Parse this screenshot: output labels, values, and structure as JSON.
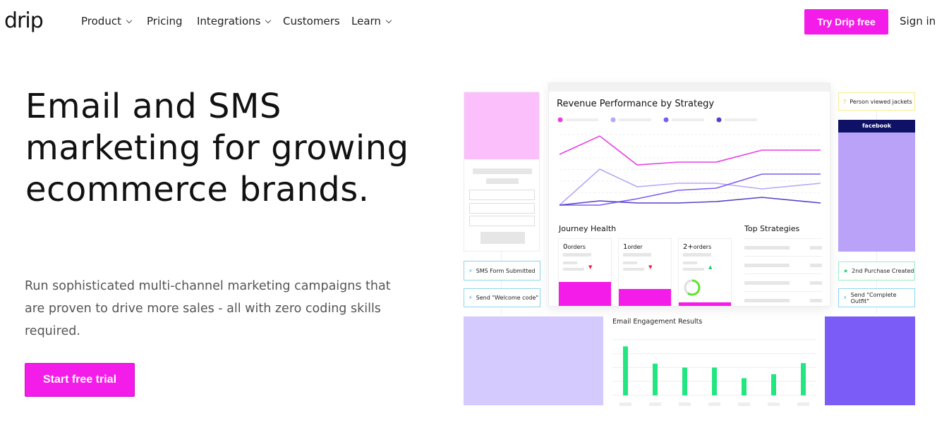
{
  "nav": {
    "logo": "drip",
    "items": [
      {
        "label": "Product",
        "dropdown": true
      },
      {
        "label": "Pricing",
        "dropdown": false
      },
      {
        "label": "Integrations",
        "dropdown": true
      },
      {
        "label": "Customers",
        "dropdown": false
      },
      {
        "label": "Learn",
        "dropdown": true
      }
    ],
    "try_label": "Try Drip free",
    "signin_label": "Sign in"
  },
  "hero": {
    "title": "Email and SMS marketing for growing ecommerce brands.",
    "subtitle": "Run sophisticated multi-channel marketing campaigns that are proven to drive more sales - all with zero coding skills required.",
    "cta_label": "Start free trial"
  },
  "illustration": {
    "revenue_title": "Revenue Performance by Strategy",
    "journey_title": "Journey Health",
    "top_title": "Top Strategies",
    "journey_cards": [
      {
        "num": "0",
        "unit": "orders",
        "trend": "down"
      },
      {
        "num": "1",
        "unit": "order",
        "trend": "down"
      },
      {
        "num": "2+",
        "unit": "orders",
        "trend": "up"
      }
    ],
    "badges": {
      "sms": "SMS Form Submitted",
      "welcome": "Send \"Welcome code\"",
      "viewed": "Person viewed jackets",
      "purchase": "2nd Purchase Created",
      "outfit": "Send \"Complete Outfit\""
    },
    "facebook": "facebook",
    "email_title": "Email Engagement Results",
    "colors": {
      "accent": "#f41ce8",
      "green": "#22e67f",
      "series": [
        "#e83ee8",
        "#b9a7f5",
        "#7b5cf0",
        "#5a3fc8"
      ]
    }
  }
}
